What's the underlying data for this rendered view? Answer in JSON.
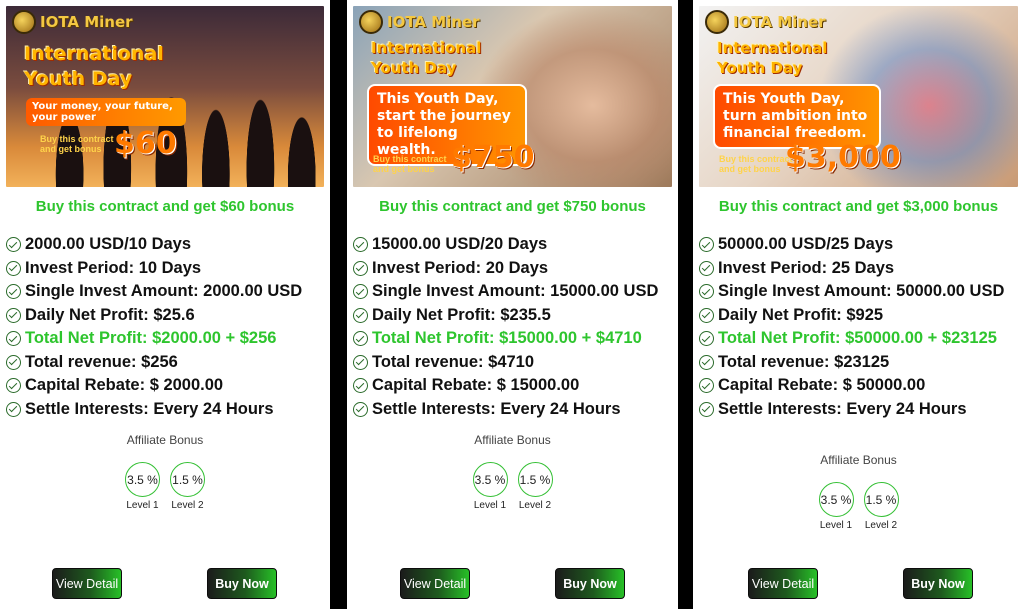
{
  "cards": [
    {
      "banner": {
        "logo": "IOTA Miner",
        "headline_1": "International",
        "headline_2": "Youth Day",
        "slogan": "Your money, your future, your power",
        "buy_line_1": "Buy this contract",
        "buy_line_2": "and get bonus",
        "amount": "$60"
      },
      "bonus_title": "Buy this contract and get $60 bonus",
      "features": [
        {
          "text": "2000.00 USD/10 Days",
          "highlight": false
        },
        {
          "text": "Invest Period: 10 Days",
          "highlight": false
        },
        {
          "text": "Single Invest Amount: 2000.00 USD",
          "highlight": false
        },
        {
          "text": "Daily Net Profit: $25.6",
          "highlight": false
        },
        {
          "text": "Total Net Profit: $2000.00 + $256",
          "highlight": true
        },
        {
          "text": "Total revenue: $256",
          "highlight": false
        },
        {
          "text": "Capital Rebate: $ 2000.00",
          "highlight": false
        },
        {
          "text": "Settle Interests: Every 24 Hours",
          "highlight": false
        }
      ],
      "affiliate": {
        "title": "Affiliate Bonus",
        "levels": [
          {
            "pct": "3.5 %",
            "label": "Level 1"
          },
          {
            "pct": "1.5 %",
            "label": "Level 2"
          }
        ]
      },
      "buttons": {
        "detail": "View Detail",
        "buy": "Buy Now"
      }
    },
    {
      "banner": {
        "logo": "IOTA Miner",
        "headline_1": "International",
        "headline_2": "Youth Day",
        "slogan": "This Youth Day, start the journey to lifelong wealth.",
        "buy_line_1": "Buy this contract",
        "buy_line_2": "and get bonus",
        "amount": "$750"
      },
      "bonus_title": "Buy this contract and get $750 bonus",
      "features": [
        {
          "text": "15000.00 USD/20 Days",
          "highlight": false
        },
        {
          "text": "Invest Period: 20 Days",
          "highlight": false
        },
        {
          "text": "Single Invest Amount: 15000.00 USD",
          "highlight": false
        },
        {
          "text": "Daily Net Profit: $235.5",
          "highlight": false
        },
        {
          "text": "Total Net Profit: $15000.00 + $4710",
          "highlight": true
        },
        {
          "text": "Total revenue: $4710",
          "highlight": false
        },
        {
          "text": "Capital Rebate: $ 15000.00",
          "highlight": false
        },
        {
          "text": "Settle Interests: Every 24 Hours",
          "highlight": false
        }
      ],
      "affiliate": {
        "title": "Affiliate Bonus",
        "levels": [
          {
            "pct": "3.5 %",
            "label": "Level 1"
          },
          {
            "pct": "1.5 %",
            "label": "Level 2"
          }
        ]
      },
      "buttons": {
        "detail": "View Detail",
        "buy": "Buy Now"
      }
    },
    {
      "banner": {
        "logo": "IOTA Miner",
        "headline_1": "International",
        "headline_2": "Youth Day",
        "slogan": "This Youth Day, turn ambition into financial freedom.",
        "buy_line_1": "Buy this contract",
        "buy_line_2": "and get bonus",
        "amount": "$3,000"
      },
      "bonus_title": "Buy this contract and get $3,000 bonus",
      "features": [
        {
          "text": "50000.00 USD/25 Days",
          "highlight": false
        },
        {
          "text": "Invest Period: 25 Days",
          "highlight": false
        },
        {
          "text": "Single Invest Amount: 50000.00 USD",
          "highlight": false
        },
        {
          "text": "Daily Net Profit: $925",
          "highlight": false
        },
        {
          "text": "Total Net Profit: $50000.00 + $23125",
          "highlight": true
        },
        {
          "text": "Total revenue: $23125",
          "highlight": false
        },
        {
          "text": "Capital Rebate: $ 50000.00",
          "highlight": false
        },
        {
          "text": "Settle Interests: Every 24 Hours",
          "highlight": false
        }
      ],
      "affiliate": {
        "title": "Affiliate Bonus",
        "levels": [
          {
            "pct": "3.5 %",
            "label": "Level 1"
          },
          {
            "pct": "1.5 %",
            "label": "Level 2"
          }
        ]
      },
      "buttons": {
        "detail": "View Detail",
        "buy": "Buy Now"
      }
    }
  ],
  "colors": {
    "accent_green": "#2ec52e",
    "banner_orange": "#ff7a00",
    "background": "#000000"
  }
}
